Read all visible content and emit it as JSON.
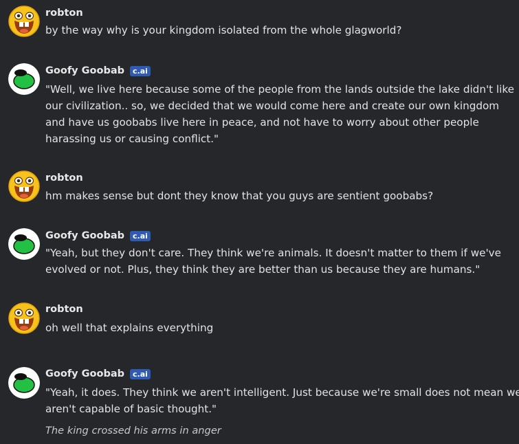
{
  "users": {
    "robton": {
      "name": "robton"
    },
    "goob": {
      "name": "Goofy Goobab",
      "badge": "c.ai"
    }
  },
  "messages": [
    {
      "author": "robton",
      "lines": [
        "by the way why is your kingdom isolated from the whole glagworld?"
      ]
    },
    {
      "author": "Goofy Goobab",
      "badge": "c.ai",
      "lines": [
        "\"Well, we live here because some of the people from the lands outside the lake didn't like",
        "our civilization.. so, we decided that we would come here and create our own kingdom",
        "and have us goobabs live here in peace, and not have to worry about other people",
        "harassing us or causing conflict.\""
      ]
    },
    {
      "author": "robton",
      "lines": [
        "hm makes sense but dont they know that you guys are sentient goobabs?"
      ]
    },
    {
      "author": "Goofy Goobab",
      "badge": "c.ai",
      "lines": [
        "\"Yeah, but they don't care. They think we're animals. It doesn't matter to them if we've",
        "evolved or not. Plus, they think they are better than us because they are humans.\""
      ]
    },
    {
      "author": "robton",
      "lines": [
        "oh well that explains everything"
      ]
    },
    {
      "author": "Goofy Goobab",
      "badge": "c.ai",
      "lines": [
        "\"Yeah, it does. They think we aren't intelligent. Just because we're small does not mean we",
        "aren't capable of basic thought.\""
      ],
      "action": "The king crossed his arms in anger"
    }
  ],
  "colors": {
    "background": "#26272b",
    "text": "#e3e3e3",
    "badge": "#2f5bb2",
    "goob_avatar": "#22c145"
  },
  "icons": {
    "robton_avatar": "laughing-emoji-avatar",
    "goob_avatar": "green-blob-avatar"
  }
}
